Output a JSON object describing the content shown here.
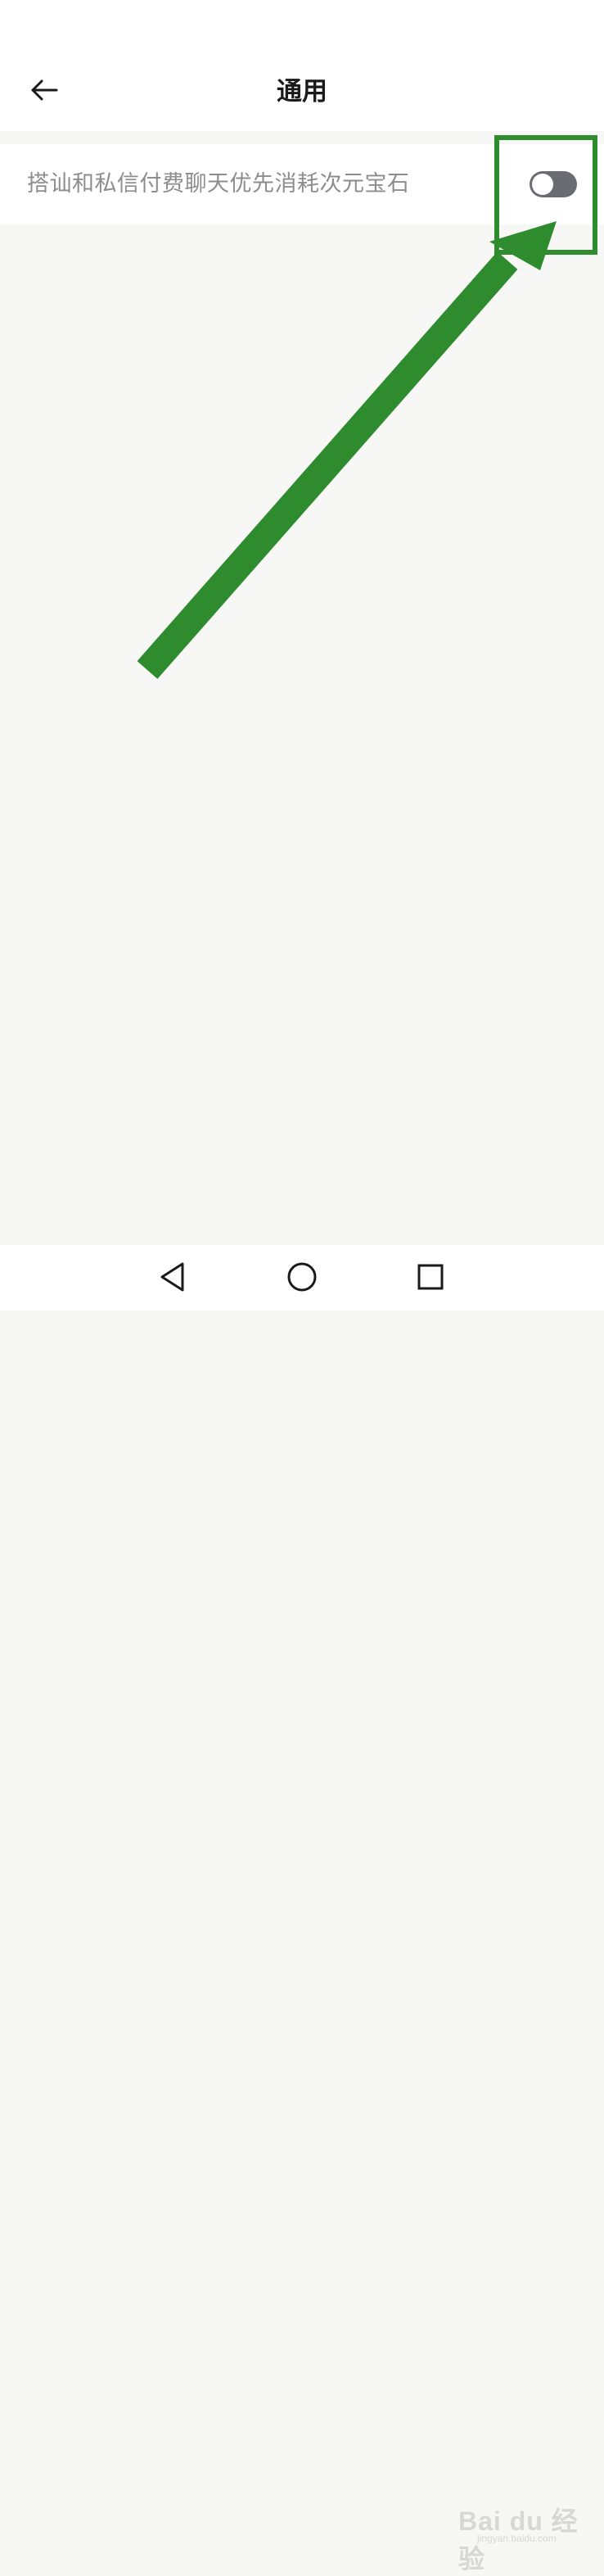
{
  "header": {
    "title": "通用",
    "back_icon": "arrow-left-icon"
  },
  "settings": {
    "items": [
      {
        "label": "搭讪和私信付费聊天优先消耗次元宝石",
        "toggle_on": false
      }
    ]
  },
  "annotation": {
    "color": "#2e8b2e"
  },
  "nav": {
    "back_icon": "triangle-back-icon",
    "home_icon": "circle-home-icon",
    "recents_icon": "square-recents-icon"
  },
  "watermark": {
    "text": "Bai du 经验",
    "sub": "jingyan.baidu.com"
  }
}
